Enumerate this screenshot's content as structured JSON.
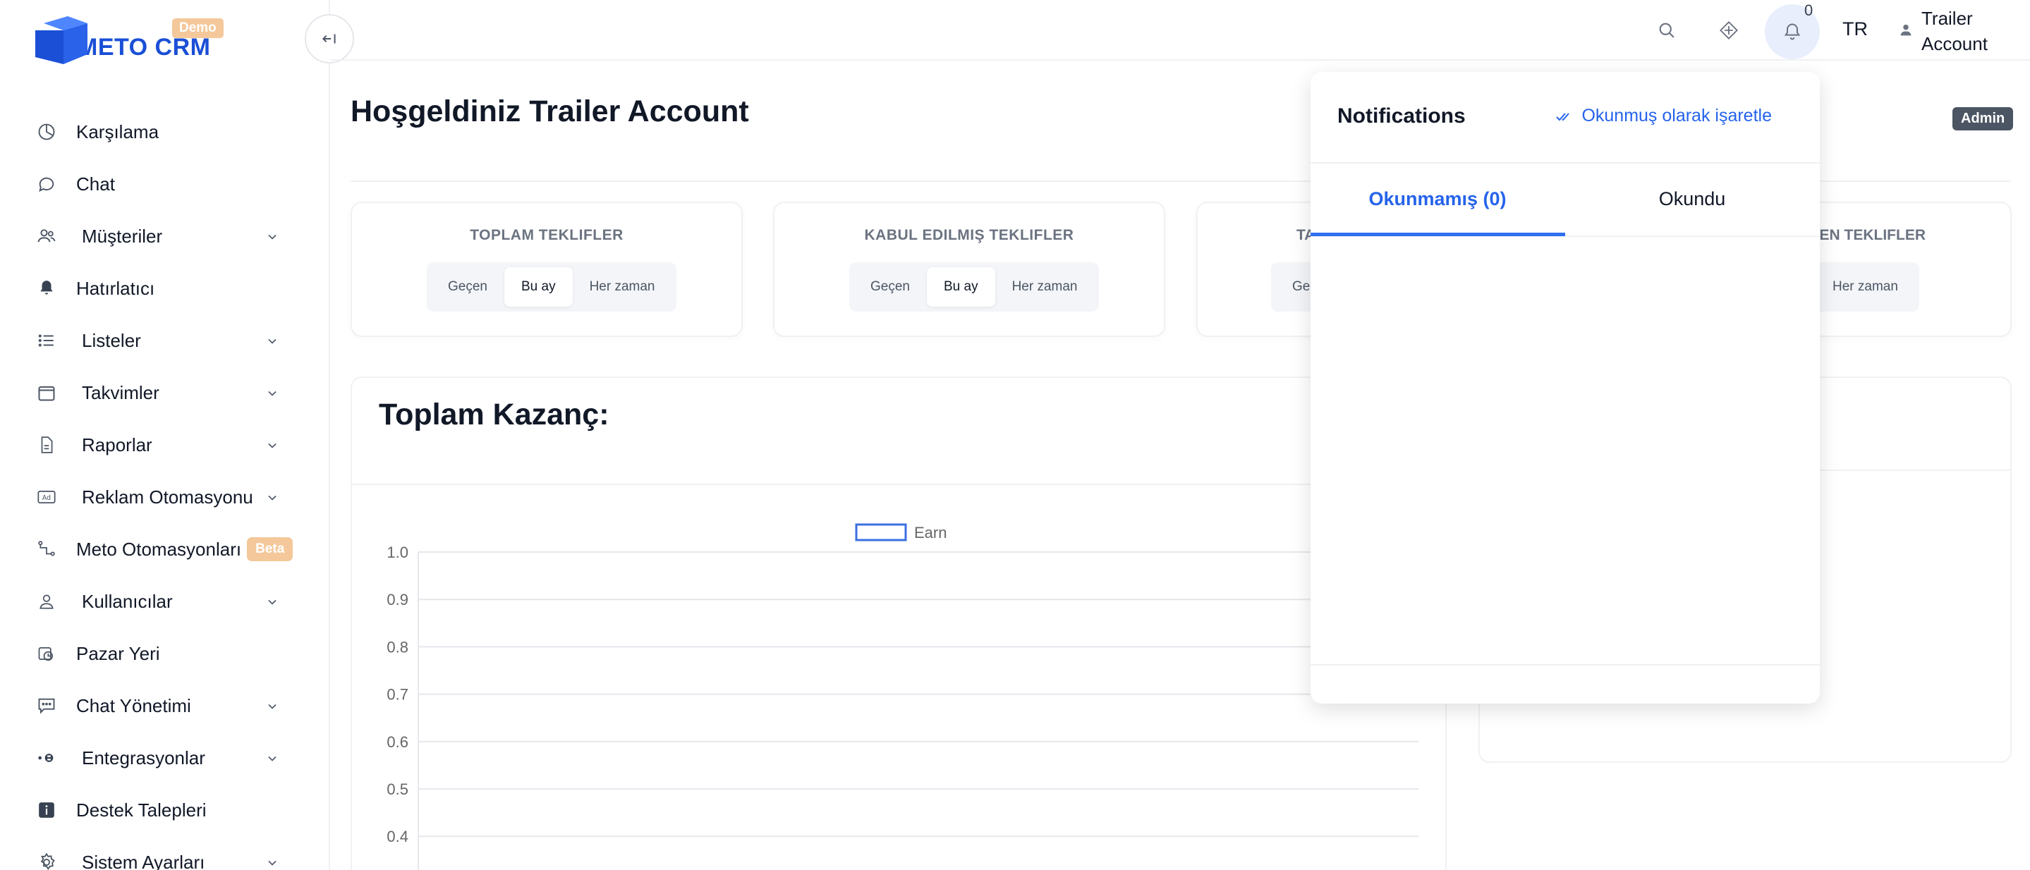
{
  "brand": {
    "name": "METO CRM",
    "badge": "Demo",
    "color": "#1a4fd6"
  },
  "sidebar": {
    "items": [
      {
        "label": "Karşılama",
        "icon": "dashboard-icon",
        "expandable": false
      },
      {
        "label": "Chat",
        "icon": "chat-bubble-icon",
        "expandable": false
      },
      {
        "label": "Müşteriler",
        "icon": "users-icon",
        "expandable": true
      },
      {
        "label": "Hatırlatıcı",
        "icon": "bell-icon",
        "expandable": false
      },
      {
        "label": "Listeler",
        "icon": "list-icon",
        "expandable": true
      },
      {
        "label": "Takvimler",
        "icon": "calendar-icon",
        "expandable": true
      },
      {
        "label": "Raporlar",
        "icon": "report-icon",
        "expandable": true
      },
      {
        "label": "Reklam Otomasyonu",
        "icon": "ad-icon",
        "expandable": true
      },
      {
        "label": "Meto Otomasyonları",
        "icon": "workflow-icon",
        "expandable": false,
        "badge": "Beta"
      },
      {
        "label": "Kullanıcılar",
        "icon": "user-icon",
        "expandable": true
      },
      {
        "label": "Pazar Yeri",
        "icon": "marketplace-icon",
        "expandable": false
      },
      {
        "label": "Chat Yönetimi",
        "icon": "chat-manage-icon",
        "expandable": true
      },
      {
        "label": "Entegrasyonlar",
        "icon": "integration-icon",
        "expandable": true
      },
      {
        "label": "Destek Talepleri",
        "icon": "info-icon",
        "expandable": false
      },
      {
        "label": "Sistem Ayarları",
        "icon": "settings-icon",
        "expandable": true
      }
    ]
  },
  "topbar": {
    "notification_count": "0",
    "language": "TR",
    "user_name_line1": "Trailer",
    "user_name_line2": "Account"
  },
  "main": {
    "title": "Hoşgeldiniz Trailer Account",
    "role_badge": "Admin",
    "cards": [
      {
        "title": "TOPLAM TEKLIFLER",
        "tabs": [
          "Geçen",
          "Bu ay",
          "Her zaman"
        ],
        "active": 1
      },
      {
        "title": "KABUL EDILMIŞ TEKLIFLER",
        "tabs": [
          "Geçen",
          "Bu ay",
          "Her zaman"
        ],
        "active": 1
      },
      {
        "title": "TA",
        "tabs": [
          "Geç"
        ],
        "active": -1
      },
      {
        "title": "EYEN TEKLIFLER",
        "tabs": [
          "Her zaman"
        ],
        "active": -1
      }
    ],
    "chart_title": "Toplam Kazanç:"
  },
  "chart_data": {
    "type": "line",
    "title": "Toplam Kazanç:",
    "series": [
      {
        "name": "Earn",
        "values": []
      }
    ],
    "legend": "top-center",
    "ylim": [
      0.4,
      1.0
    ],
    "yticks": [
      "1.0",
      "0.9",
      "0.8",
      "0.7",
      "0.6",
      "0.5",
      "0.4"
    ],
    "grid": true,
    "colors": {
      "Earn": "#3b6fe0"
    }
  },
  "notifications": {
    "title": "Notifications",
    "mark_read": "Okunmuş olarak işaretle",
    "tab_unread": "Okunmamış (0)",
    "tab_read": "Okundu"
  }
}
